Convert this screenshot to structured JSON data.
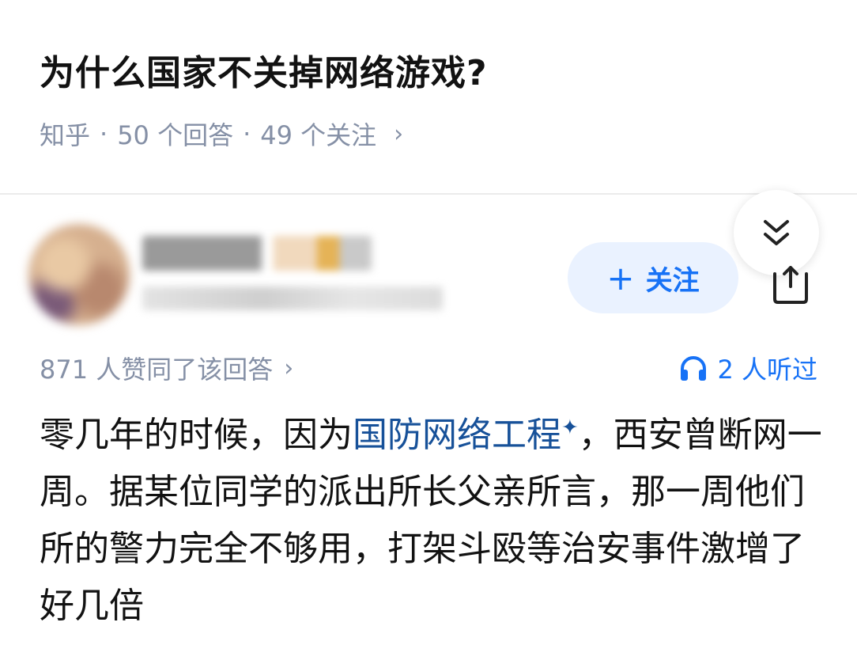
{
  "question": {
    "title": "为什么国家不关掉网络游戏?",
    "source": "知乎",
    "answers_count": "50 个回答",
    "followers_count": "49 个关注"
  },
  "author": {
    "follow_label": "关注"
  },
  "answer": {
    "likes_text": "871 人赞同了该回答",
    "listened_text": "2 人听过",
    "text_before_link": "零几年的时候，因为",
    "link_text": "国防网络工程",
    "text_after_link": "，西安曾断网一周。据某位同学的派出所长父亲所言，那一周他们所的警力完全不够用，打架斗殴等治安事件激增了好几倍"
  },
  "colors": {
    "accent": "#1772f6",
    "link": "#175199",
    "meta_gray": "#8590a6"
  }
}
